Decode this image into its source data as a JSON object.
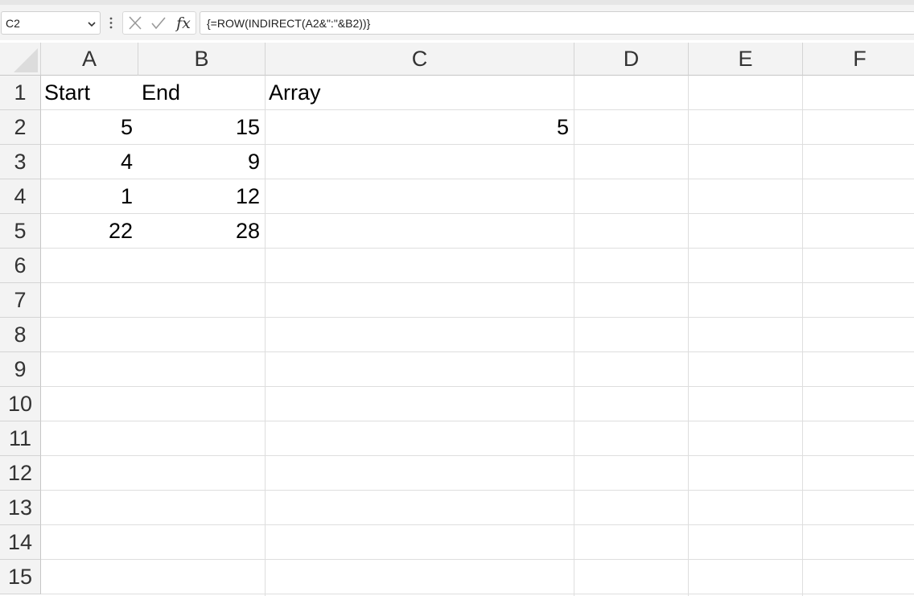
{
  "name_box": {
    "value": "C2"
  },
  "formula_bar": {
    "fx_label": "fx",
    "formula": "{=ROW(INDIRECT(A2&\":\"&B2))}"
  },
  "columns": [
    "A",
    "B",
    "C",
    "D",
    "E",
    "F"
  ],
  "rows": [
    "1",
    "2",
    "3",
    "4",
    "5",
    "6",
    "7",
    "8",
    "9",
    "10",
    "11",
    "12",
    "13",
    "14",
    "15"
  ],
  "cells": {
    "A1": "Start",
    "B1": "End",
    "C1": "Array",
    "A2": "5",
    "B2": "15",
    "C2": "5",
    "A3": "4",
    "B3": "9",
    "A4": "1",
    "B4": "12",
    "A5": "22",
    "B5": "28"
  }
}
